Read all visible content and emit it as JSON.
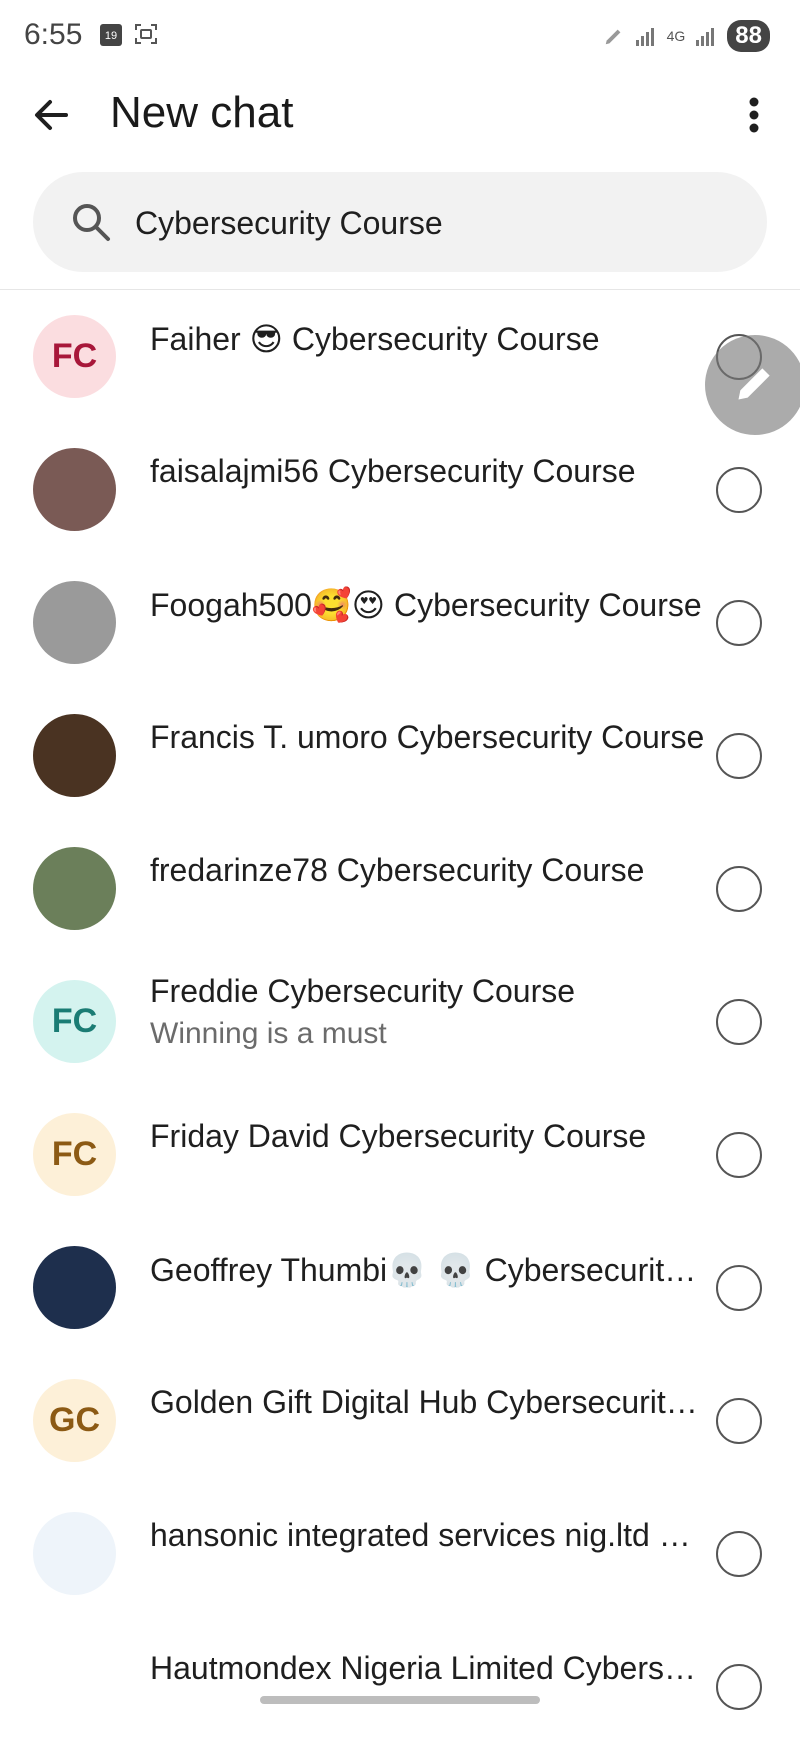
{
  "status_bar": {
    "time": "6:55",
    "calendar_day": "19",
    "network": "4G",
    "battery": "88"
  },
  "app_bar": {
    "title": "New chat",
    "back_icon": "arrow-left-icon",
    "more_icon": "more-vert-icon"
  },
  "search": {
    "icon": "search-icon",
    "value": "Cybersecurity Course",
    "placeholder": ""
  },
  "contacts": [
    {
      "name": "Faiher 😎 Cybersecurity Course",
      "subtitle": "",
      "avatar_text": "FC",
      "avatar_bg": "#fbdde0",
      "avatar_fg": "#a8173a"
    },
    {
      "name": "faisalajmi56 Cybersecurity Course",
      "subtitle": "",
      "avatar_text": "",
      "avatar_bg": "#7a5a55",
      "avatar_fg": "#ffffff"
    },
    {
      "name": "Foogah500🥰😍 Cybersecurity Course",
      "subtitle": "",
      "avatar_text": "",
      "avatar_bg": "#9a9a9a",
      "avatar_fg": "#ffffff"
    },
    {
      "name": "Francis T. umoro Cybersecurity Course",
      "subtitle": "",
      "avatar_text": "",
      "avatar_bg": "#4a3322",
      "avatar_fg": "#ffffff"
    },
    {
      "name": "fredarinze78 Cybersecurity Course",
      "subtitle": "",
      "avatar_text": "",
      "avatar_bg": "#6b7f5a",
      "avatar_fg": "#ffffff"
    },
    {
      "name": "Freddie Cybersecurity Course",
      "subtitle": "Winning is a must",
      "avatar_text": "FC",
      "avatar_bg": "#d4f3ef",
      "avatar_fg": "#1a7c74"
    },
    {
      "name": "Friday David Cybersecurity Course",
      "subtitle": "",
      "avatar_text": "FC",
      "avatar_bg": "#fdf0d8",
      "avatar_fg": "#8c5a14"
    },
    {
      "name": "Geoffrey Thumbi💀 💀 Cybersecurity Course",
      "subtitle": "",
      "avatar_text": "",
      "avatar_bg": "#1e2f4d",
      "avatar_fg": "#ffffff"
    },
    {
      "name": "Golden Gift Digital Hub Cybersecurity Course",
      "subtitle": "",
      "avatar_text": "GC",
      "avatar_bg": "#fdf0d8",
      "avatar_fg": "#8c5a14"
    },
    {
      "name": "hansonic integrated services nig.ltd Cybersecurity Course",
      "subtitle": "",
      "avatar_text": "",
      "avatar_bg": "#eef4fa",
      "avatar_fg": "#c0182c"
    },
    {
      "name": "Hautmondex Nigeria Limited Cybersecurity Course",
      "subtitle": "",
      "avatar_text": "",
      "avatar_bg": "#ffffff",
      "avatar_fg": "#1a7c74"
    }
  ],
  "fab": {
    "icon": "pencil-icon"
  }
}
